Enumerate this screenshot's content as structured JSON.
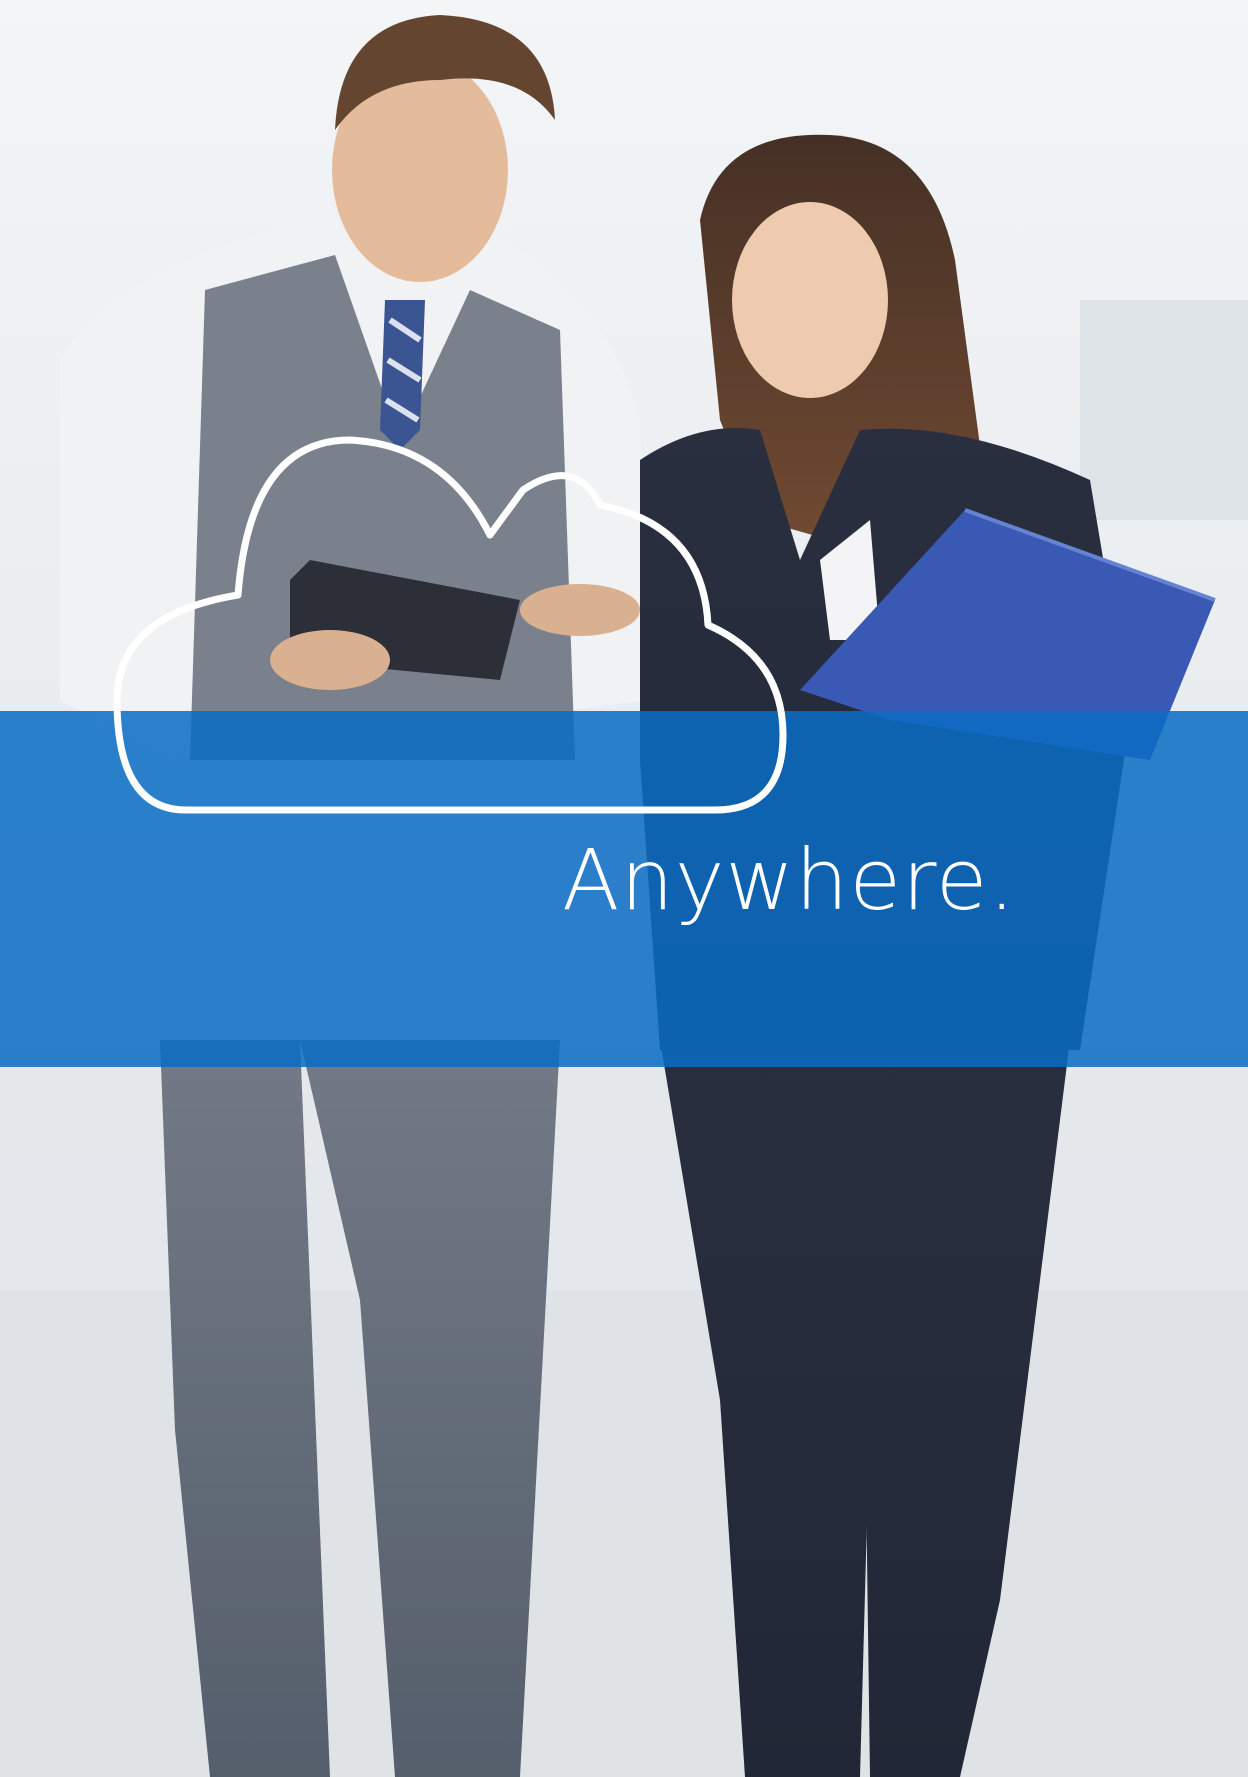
{
  "headline": "Anywhere.",
  "colors": {
    "band": "#0a6cc4",
    "cloud_outline": "#ffffff",
    "headline_text": "#ffffff"
  },
  "icons": {
    "cloud": "cloud-icon"
  }
}
